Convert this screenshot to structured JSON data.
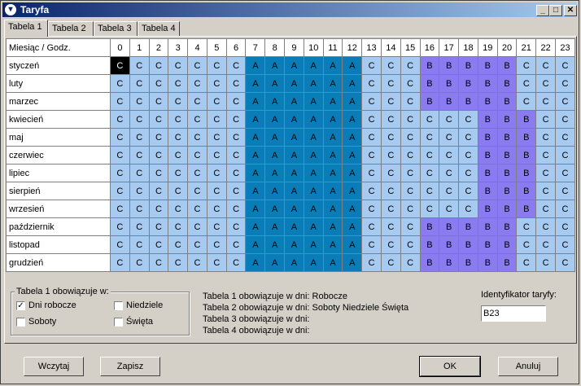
{
  "window": {
    "title": "Taryfa",
    "min": "_",
    "max": "□",
    "close": "✕"
  },
  "tabs": [
    "Tabela 1",
    "Tabela 2",
    "Tabela 3",
    "Tabela 4"
  ],
  "grid": {
    "corner": "Miesiąc / Godz.",
    "hours": [
      "0",
      "1",
      "2",
      "3",
      "4",
      "5",
      "6",
      "7",
      "8",
      "9",
      "10",
      "11",
      "12",
      "13",
      "14",
      "15",
      "16",
      "17",
      "18",
      "19",
      "20",
      "21",
      "22",
      "23"
    ],
    "rows": [
      {
        "month": "styczeń",
        "cells": [
          "C",
          "C",
          "C",
          "C",
          "C",
          "C",
          "C",
          "A",
          "A",
          "A",
          "A",
          "A",
          "A",
          "C",
          "C",
          "C",
          "B",
          "B",
          "B",
          "B",
          "B",
          "C",
          "C",
          "C"
        ]
      },
      {
        "month": "luty",
        "cells": [
          "C",
          "C",
          "C",
          "C",
          "C",
          "C",
          "C",
          "A",
          "A",
          "A",
          "A",
          "A",
          "A",
          "C",
          "C",
          "C",
          "B",
          "B",
          "B",
          "B",
          "B",
          "C",
          "C",
          "C"
        ]
      },
      {
        "month": "marzec",
        "cells": [
          "C",
          "C",
          "C",
          "C",
          "C",
          "C",
          "C",
          "A",
          "A",
          "A",
          "A",
          "A",
          "A",
          "C",
          "C",
          "C",
          "B",
          "B",
          "B",
          "B",
          "B",
          "C",
          "C",
          "C"
        ]
      },
      {
        "month": "kwiecień",
        "cells": [
          "C",
          "C",
          "C",
          "C",
          "C",
          "C",
          "C",
          "A",
          "A",
          "A",
          "A",
          "A",
          "A",
          "C",
          "C",
          "C",
          "C",
          "C",
          "C",
          "B",
          "B",
          "B",
          "C",
          "C"
        ]
      },
      {
        "month": "maj",
        "cells": [
          "C",
          "C",
          "C",
          "C",
          "C",
          "C",
          "C",
          "A",
          "A",
          "A",
          "A",
          "A",
          "A",
          "C",
          "C",
          "C",
          "C",
          "C",
          "C",
          "B",
          "B",
          "B",
          "C",
          "C"
        ]
      },
      {
        "month": "czerwiec",
        "cells": [
          "C",
          "C",
          "C",
          "C",
          "C",
          "C",
          "C",
          "A",
          "A",
          "A",
          "A",
          "A",
          "A",
          "C",
          "C",
          "C",
          "C",
          "C",
          "C",
          "B",
          "B",
          "B",
          "C",
          "C"
        ]
      },
      {
        "month": "lipiec",
        "cells": [
          "C",
          "C",
          "C",
          "C",
          "C",
          "C",
          "C",
          "A",
          "A",
          "A",
          "A",
          "A",
          "A",
          "C",
          "C",
          "C",
          "C",
          "C",
          "C",
          "B",
          "B",
          "B",
          "C",
          "C"
        ]
      },
      {
        "month": "sierpień",
        "cells": [
          "C",
          "C",
          "C",
          "C",
          "C",
          "C",
          "C",
          "A",
          "A",
          "A",
          "A",
          "A",
          "A",
          "C",
          "C",
          "C",
          "C",
          "C",
          "C",
          "B",
          "B",
          "B",
          "C",
          "C"
        ]
      },
      {
        "month": "wrzesień",
        "cells": [
          "C",
          "C",
          "C",
          "C",
          "C",
          "C",
          "C",
          "A",
          "A",
          "A",
          "A",
          "A",
          "A",
          "C",
          "C",
          "C",
          "C",
          "C",
          "C",
          "B",
          "B",
          "B",
          "C",
          "C"
        ]
      },
      {
        "month": "październik",
        "cells": [
          "C",
          "C",
          "C",
          "C",
          "C",
          "C",
          "C",
          "A",
          "A",
          "A",
          "A",
          "A",
          "A",
          "C",
          "C",
          "C",
          "B",
          "B",
          "B",
          "B",
          "B",
          "C",
          "C",
          "C"
        ]
      },
      {
        "month": "listopad",
        "cells": [
          "C",
          "C",
          "C",
          "C",
          "C",
          "C",
          "C",
          "A",
          "A",
          "A",
          "A",
          "A",
          "A",
          "C",
          "C",
          "C",
          "B",
          "B",
          "B",
          "B",
          "B",
          "C",
          "C",
          "C"
        ]
      },
      {
        "month": "grudzień",
        "cells": [
          "C",
          "C",
          "C",
          "C",
          "C",
          "C",
          "C",
          "A",
          "A",
          "A",
          "A",
          "A",
          "A",
          "C",
          "C",
          "C",
          "B",
          "B",
          "B",
          "B",
          "B",
          "C",
          "C",
          "C"
        ]
      }
    ],
    "selected": {
      "row": 0,
      "col": 0
    },
    "colors": {
      "C": "#a6caf0",
      "A": "#0a7db8",
      "B": "#8a7cf0"
    }
  },
  "daysGroup": {
    "legend": "Tabela 1 obowiązuje w:",
    "dni_robocze": {
      "label": "Dni robocze",
      "checked": true
    },
    "niedziele": {
      "label": "Niedziele",
      "checked": false
    },
    "soboty": {
      "label": "Soboty",
      "checked": false
    },
    "swieta": {
      "label": "Święta",
      "checked": false
    }
  },
  "info": [
    "Tabela 1 obowiązuje w dni: Robocze",
    "Tabela 2 obowiązuje w dni: Soboty Niedziele Święta",
    "Tabela 3 obowiązuje w dni:",
    "Tabela 4 obowiązuje w dni:"
  ],
  "tariffId": {
    "label": "Identyfikator taryfy:",
    "value": "B23"
  },
  "buttons": {
    "load": "Wczytaj",
    "save": "Zapisz",
    "ok": "OK",
    "cancel": "Anuluj"
  }
}
